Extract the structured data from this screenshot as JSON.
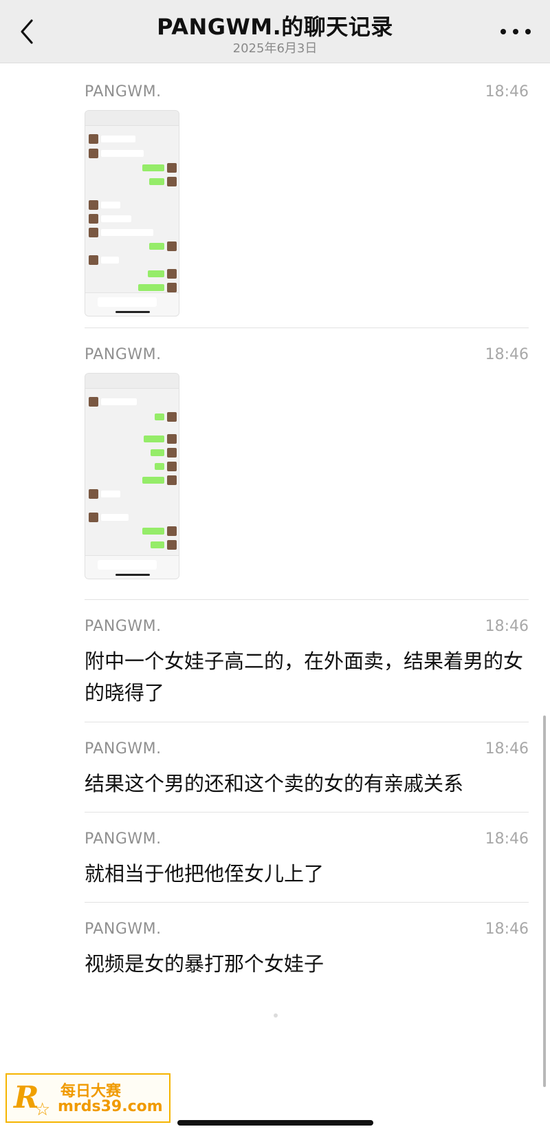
{
  "header": {
    "title": "PANGWM.的聊天记录",
    "date": "2025年6月3日"
  },
  "messages": [
    {
      "type": "image",
      "sender": "PANGWM.",
      "time": "18:46",
      "image_desc": "chat-screenshot-1"
    },
    {
      "type": "image",
      "sender": "PANGWM.",
      "time": "18:46",
      "image_desc": "chat-screenshot-2"
    },
    {
      "type": "text",
      "sender": "PANGWM.",
      "time": "18:46",
      "text": "附中一个女娃子高二的，在外面卖，结果着男的女的晓得了"
    },
    {
      "type": "text",
      "sender": "PANGWM.",
      "time": "18:46",
      "text": "结果这个男的还和这个卖的女的有亲戚关系"
    },
    {
      "type": "text",
      "sender": "PANGWM.",
      "time": "18:46",
      "text": "就相当于他把他侄女儿上了"
    },
    {
      "type": "text",
      "sender": "PANGWM.",
      "time": "18:46",
      "text": "视频是女的暴打那个女娃子"
    }
  ],
  "watermark": {
    "logo": "R",
    "title": "每日大赛",
    "url": "mrds39.com"
  },
  "icons": {
    "back": "chevron-left-icon",
    "more": "more-horizontal-icon"
  }
}
